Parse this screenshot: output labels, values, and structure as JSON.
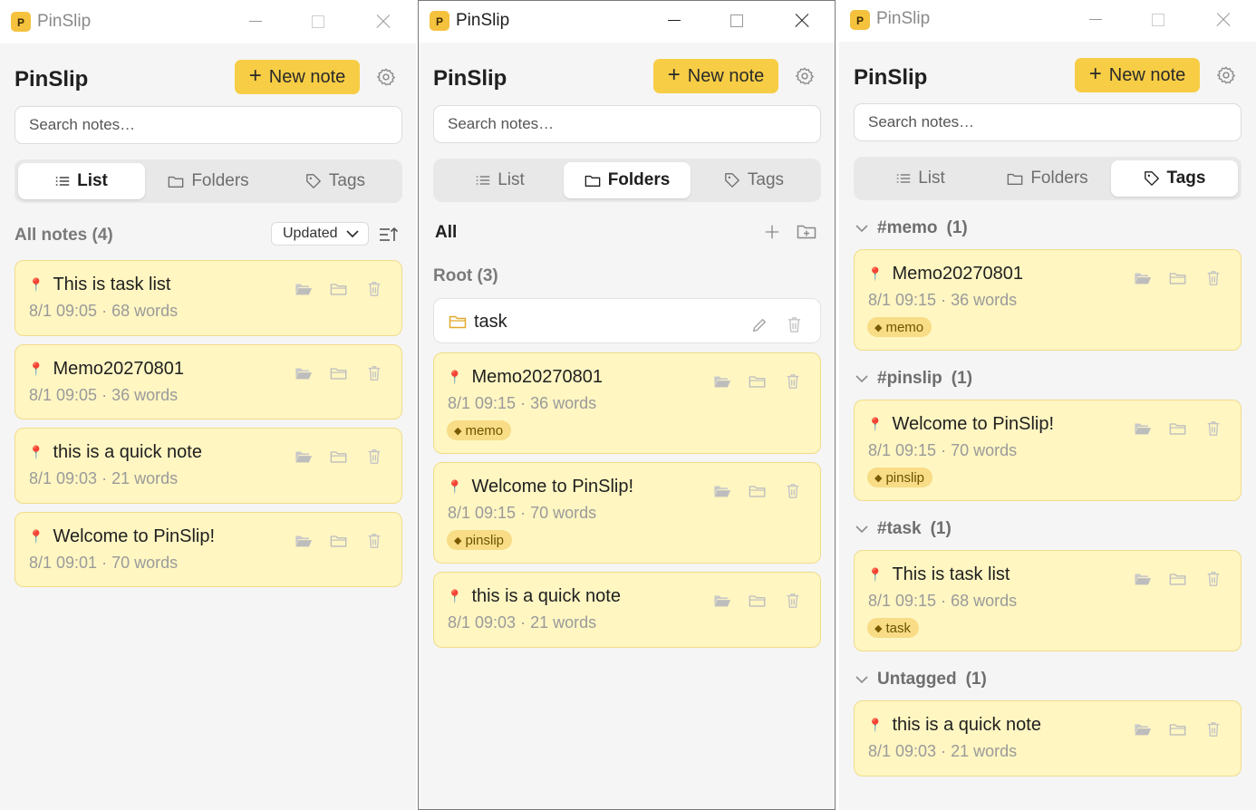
{
  "app": {
    "title": "PinSlip",
    "name": "PinSlip",
    "icon_letter": "P",
    "new_note_label": "New note",
    "search_placeholder": "Search notes…"
  },
  "tabs": {
    "list": "List",
    "folders": "Folders",
    "tags": "Tags"
  },
  "colors": {
    "accent": "#f7cd45",
    "card_bg": "#fff6c2",
    "tag_chip": "#f8dc86",
    "pin": "#d8312b"
  },
  "win1": {
    "active_tab": "List",
    "section_label": "All notes (4)",
    "sort_value": "Updated",
    "notes": [
      {
        "title": "This is task list",
        "meta": "8/1 09:05 · 68 words"
      },
      {
        "title": "Memo20270801",
        "meta": "8/1 09:05 · 36 words"
      },
      {
        "title": "this is a quick note",
        "meta": "8/1 09:03 · 21 words"
      },
      {
        "title": "Welcome to PinSlip!",
        "meta": "8/1 09:01 · 70 words"
      }
    ]
  },
  "win2": {
    "active_tab": "Folders",
    "all_label": "All",
    "root_label": "Root (3)",
    "folder": {
      "name": "task"
    },
    "notes": [
      {
        "title": "Memo20270801",
        "meta": "8/1 09:15 · 36 words",
        "tag": "memo"
      },
      {
        "title": "Welcome to PinSlip!",
        "meta": "8/1 09:15 · 70 words",
        "tag": "pinslip"
      },
      {
        "title": "this is a quick note",
        "meta": "8/1 09:03 · 21 words"
      }
    ]
  },
  "win3": {
    "active_tab": "Tags",
    "groups": [
      {
        "label": "#memo",
        "count": "(1)",
        "note": {
          "title": "Memo20270801",
          "meta": "8/1 09:15 · 36 words",
          "tag": "memo"
        }
      },
      {
        "label": "#pinslip",
        "count": "(1)",
        "note": {
          "title": "Welcome to PinSlip!",
          "meta": "8/1 09:15 · 70 words",
          "tag": "pinslip"
        }
      },
      {
        "label": "#task",
        "count": "(1)",
        "note": {
          "title": "This is task list",
          "meta": "8/1 09:15 · 68 words",
          "tag": "task"
        }
      },
      {
        "label": "Untagged",
        "count": "(1)",
        "note": {
          "title": "this is a quick note",
          "meta": "8/1 09:03 · 21 words"
        }
      }
    ]
  }
}
